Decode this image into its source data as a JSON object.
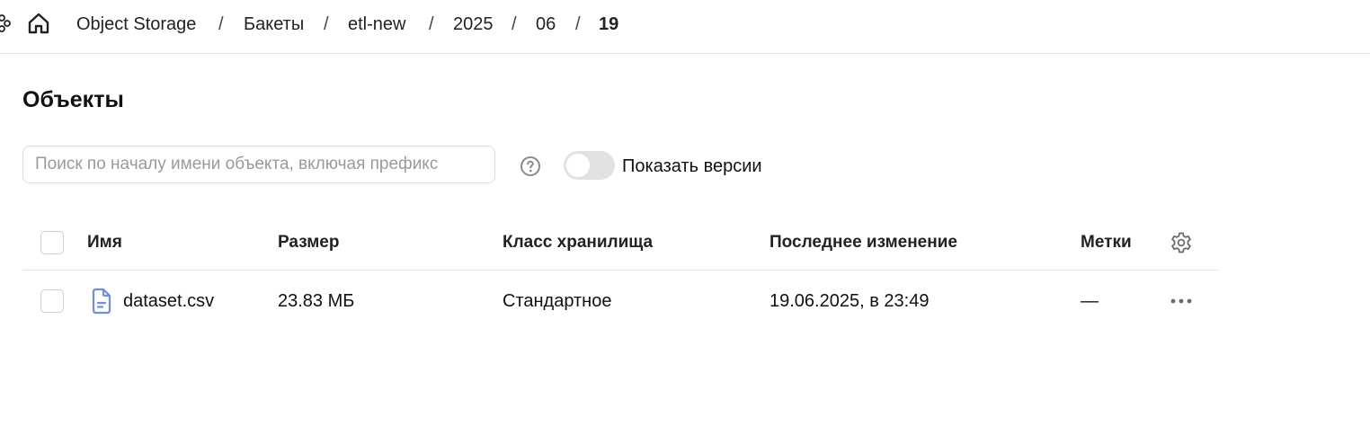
{
  "breadcrumb": {
    "items": [
      "Object Storage",
      "Бакеты",
      "etl-new",
      "2025",
      "06",
      "19"
    ],
    "separator": "/"
  },
  "page": {
    "title": "Объекты"
  },
  "search": {
    "placeholder": "Поиск по началу имени объекта, включая префикс",
    "value": ""
  },
  "versions_toggle": {
    "label": "Показать версии",
    "enabled": false
  },
  "table": {
    "columns": [
      "Имя",
      "Размер",
      "Класс хранилища",
      "Последнее изменение",
      "Метки"
    ],
    "rows": [
      {
        "name": "dataset.csv",
        "size": "23.83 МБ",
        "storage_class": "Стандартное",
        "modified": "19.06.2025, в 23:49",
        "labels": "—",
        "icon": "file-icon"
      }
    ]
  },
  "colors": {
    "accent": "#6d8ef0",
    "border": "#e5e5e5",
    "text": "#111111",
    "placeholder": "#9a9a9a"
  }
}
